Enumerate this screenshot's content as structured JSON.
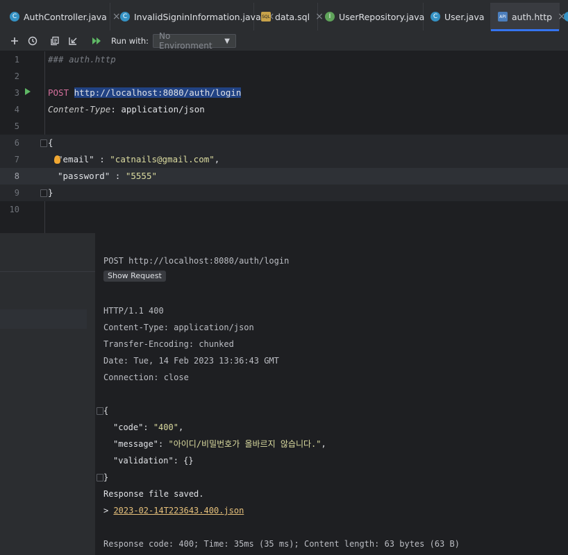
{
  "tabs": [
    {
      "label": "AuthController.java",
      "icon": "class-icon",
      "glyph": "C",
      "active": false
    },
    {
      "label": "InvalidSigninInformation.java",
      "icon": "class-icon",
      "glyph": "C",
      "active": false
    },
    {
      "label": "data.sql",
      "icon": "sql-file-icon",
      "glyph": "SQL",
      "active": false
    },
    {
      "label": "UserRepository.java",
      "icon": "interface-icon",
      "glyph": "I",
      "active": false
    },
    {
      "label": "User.java",
      "icon": "class-icon",
      "glyph": "C",
      "active": false
    },
    {
      "label": "auth.http",
      "icon": "http-file-icon",
      "glyph": "API",
      "active": true
    }
  ],
  "tab_close_glyph": "×",
  "toolbar": {
    "run_with_label": "Run with:",
    "environment": "No Environment"
  },
  "editor": {
    "lines": [
      {
        "num": "1",
        "text": "### auth.http"
      },
      {
        "num": "2",
        "text": ""
      },
      {
        "num": "3",
        "method": "POST",
        "url": "http://localhost:8080/auth/login"
      },
      {
        "num": "4",
        "header_name": "Content-Type",
        "header_value": ": application/json"
      },
      {
        "num": "5",
        "text": ""
      },
      {
        "num": "6",
        "text": "{"
      },
      {
        "num": "7",
        "key": "\"email\"",
        "sep": " : ",
        "value": "\"catnails@gmail.com\"",
        "tail": ","
      },
      {
        "num": "8",
        "key": "\"password\"",
        "sep": " : ",
        "value": "\"5555\"",
        "tail": ""
      },
      {
        "num": "9",
        "text": "}"
      },
      {
        "num": "10",
        "text": ""
      }
    ]
  },
  "response": {
    "request_line": "POST http://localhost:8080/auth/login",
    "show_request_label": "Show Request",
    "status_line": "HTTP/1.1 400",
    "headers": [
      "Content-Type: application/json",
      "Transfer-Encoding: chunked",
      "Date: Tue, 14 Feb 2023 13:36:43 GMT",
      "Connection: close"
    ],
    "body_open": "{",
    "body": [
      {
        "key": "\"code\"",
        "value": "\"400\"",
        "tail": ","
      },
      {
        "key": "\"message\"",
        "value": "\"아이디/비밀번호가 올바르지 않습니다.\"",
        "tail": ","
      },
      {
        "key": "\"validation\"",
        "value": "{}",
        "tail": ""
      }
    ],
    "body_close": "}",
    "saved_text": "Response file saved.",
    "file_prefix": "> ",
    "file_link": "2023-02-14T223643.400.json",
    "summary": "Response code: 400; Time: 35ms (35 ms); Content length: 63 bytes (63 B)"
  }
}
